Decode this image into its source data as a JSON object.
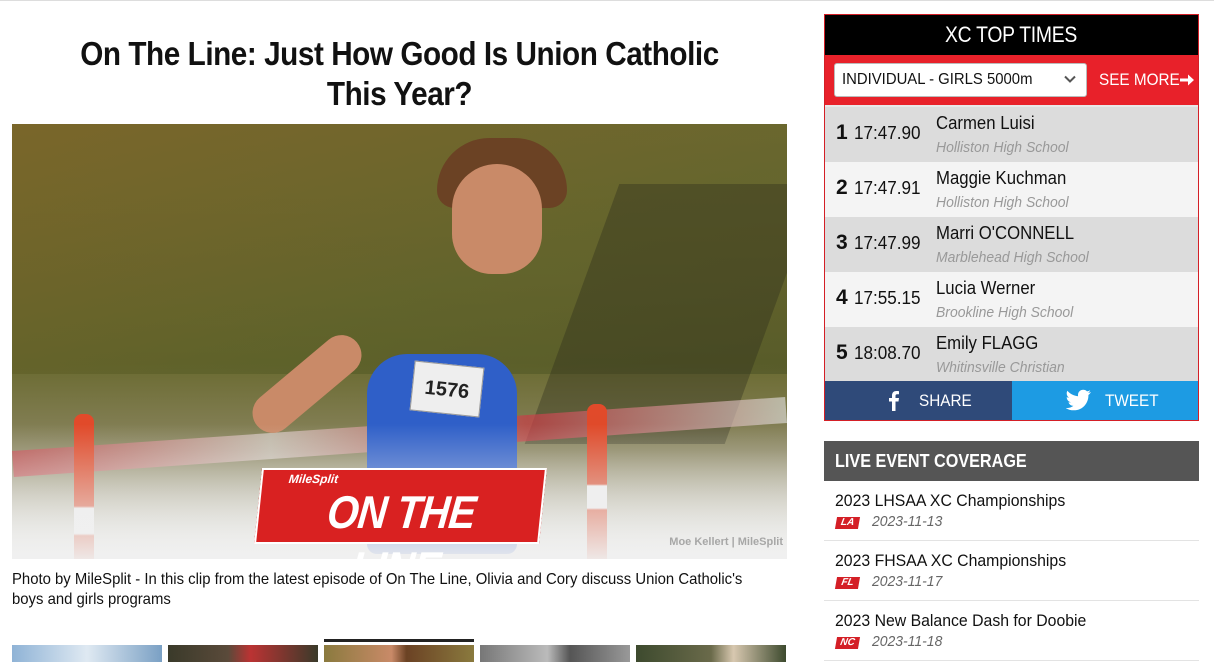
{
  "article": {
    "headline": "On The Line: Just How Good Is Union Catholic This Year?",
    "hero": {
      "bib_number": "1576",
      "logo_small": "MileSplit",
      "logo_big": "ON THE LINE",
      "photo_credit": "Moe Kellert | MileSplit"
    },
    "caption": "Photo by MileSplit - In this clip from the latest episode of On The Line, Olivia and Cory discuss Union Catholic's boys and girls programs"
  },
  "top_times": {
    "title": "XC TOP TIMES",
    "select_value": "INDIVIDUAL - GIRLS 5000m",
    "see_more_label": "SEE MORE",
    "rows": [
      {
        "rank": "1",
        "time": "17:47.90",
        "name": "Carmen Luisi",
        "school": "Holliston High School"
      },
      {
        "rank": "2",
        "time": "17:47.91",
        "name": "Maggie Kuchman",
        "school": "Holliston High School"
      },
      {
        "rank": "3",
        "time": "17:47.99",
        "name": "Marri O'CONNELL",
        "school": "Marblehead High School"
      },
      {
        "rank": "4",
        "time": "17:55.15",
        "name": "Lucia Werner",
        "school": "Brookline High School"
      },
      {
        "rank": "5",
        "time": "18:08.70",
        "name": "Emily FLAGG",
        "school": "Whitinsville Christian"
      }
    ],
    "share_label": "SHARE",
    "tweet_label": "TWEET"
  },
  "live_coverage": {
    "title": "LIVE EVENT COVERAGE",
    "items": [
      {
        "title": "2023 LHSAA XC Championships",
        "state": "LA",
        "date": "2023-11-13"
      },
      {
        "title": "2023 FHSAA XC Championships",
        "state": "FL",
        "date": "2023-11-17"
      },
      {
        "title": "2023 New Balance Dash for Doobie",
        "state": "NC",
        "date": "2023-11-18"
      }
    ]
  },
  "colors": {
    "brand_red": "#e8212a",
    "facebook_blue": "#2f4a79",
    "twitter_blue": "#1d9be3"
  },
  "icons": [
    "chevron-down-icon",
    "arrow-right-icon",
    "facebook-icon",
    "twitter-icon"
  ]
}
